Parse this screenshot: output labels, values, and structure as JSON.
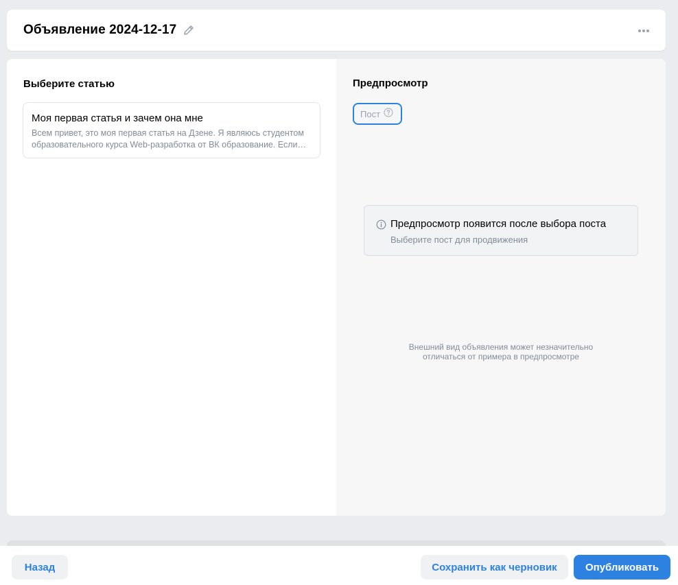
{
  "header": {
    "title": "Объявление 2024-12-17",
    "edit_icon": "pencil-icon",
    "more_icon": "more-horizontal-icon"
  },
  "left": {
    "heading": "Выберите статью",
    "article": {
      "title": "Моя первая статья и зачем она мне",
      "description": "Всем привет, это моя первая статья на Дзене. Я являюсь студентом образовательного курса Web-разработка от ВК образование. Если вам интересно, о чём будет этот блог, читайте дальше."
    }
  },
  "preview": {
    "heading": "Предпросмотр",
    "chip_label": "Пост",
    "chip_help_icon": "help-circle-icon",
    "placeholder_title": "Предпросмотр появится после выбора поста",
    "placeholder_subtitle": "Выберите пост для продвижения",
    "placeholder_icon": "info-icon",
    "disclaimer": "Внешний вид объявления может незначительно отличаться от примера в предпросмотре"
  },
  "footer": {
    "back_label": "Назад",
    "draft_label": "Сохранить как черновик",
    "publish_label": "Опубликовать"
  },
  "colors": {
    "accent": "#2d81e0",
    "background": "#ebecef",
    "secondary_text": "#818c99"
  }
}
